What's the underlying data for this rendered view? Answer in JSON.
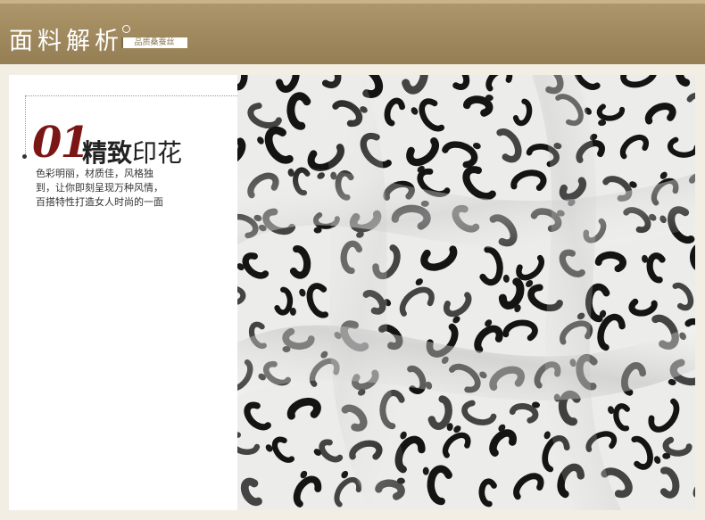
{
  "header": {
    "title": "面料解析",
    "badge": "品质桑蚕丝"
  },
  "feature": {
    "number": "01",
    "title_bold": "精致",
    "title_light": "印花",
    "description_lines": [
      "色彩明丽，材质佳，风格独",
      "到，让你即刻呈现万种风情，",
      "百搭特性打造女人时尚的一面"
    ]
  },
  "photo": {
    "subject": "leopard-print-silk-fabric"
  },
  "colors": {
    "header_bg": "#a38c60",
    "accent_number": "#7a1616",
    "page_bg": "#f3eee4"
  }
}
